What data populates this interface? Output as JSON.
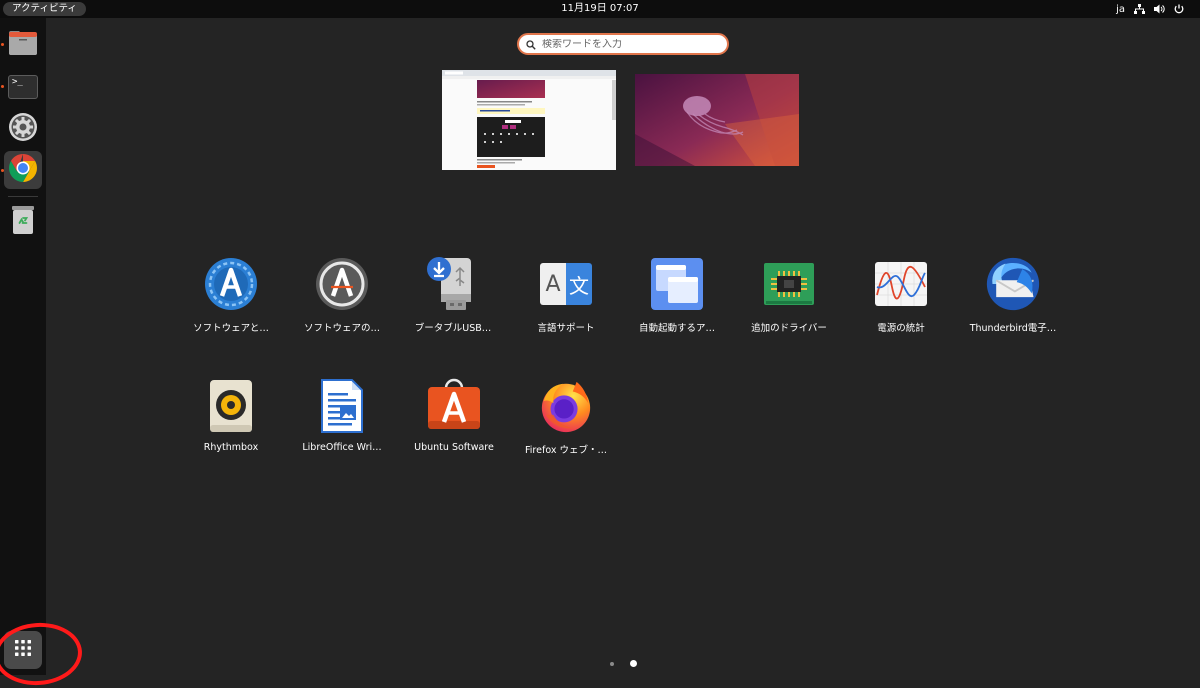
{
  "topbar": {
    "activities": "アクティビティ",
    "clock": "11月19日  07:07",
    "input_method": "ja"
  },
  "dock": {
    "items": [
      {
        "name": "files",
        "icon": "folder-icon",
        "running": true
      },
      {
        "name": "terminal",
        "icon": "terminal-icon",
        "running": true,
        "glyph": ">_"
      },
      {
        "name": "settings",
        "icon": "gear-icon",
        "running": false
      },
      {
        "name": "chrome",
        "icon": "chrome-icon",
        "running": true,
        "active": true
      },
      {
        "name": "trash",
        "icon": "trash-icon",
        "running": false
      }
    ],
    "show_apps_icon": "app-grid-icon"
  },
  "search": {
    "placeholder": "検索ワードを入力"
  },
  "windows": [
    {
      "name": "browser-window"
    },
    {
      "name": "desktop-wallpaper"
    }
  ],
  "apps": [
    {
      "label": "ソフトウェアと…",
      "icon": "software-updates-icon"
    },
    {
      "label": "ソフトウェアの…",
      "icon": "software-updater-icon"
    },
    {
      "label": "ブータブルUSB…",
      "icon": "usb-creator-icon"
    },
    {
      "label": "言語サポート",
      "icon": "language-support-icon",
      "glyph_a": "A",
      "glyph_b": "文"
    },
    {
      "label": "自動起動するア…",
      "icon": "startup-apps-icon"
    },
    {
      "label": "追加のドライバー",
      "icon": "drivers-chip-icon"
    },
    {
      "label": "電源の統計",
      "icon": "power-statistics-icon"
    },
    {
      "label": "Thunderbird電子…",
      "icon": "thunderbird-icon"
    },
    {
      "label": "Rhythmbox",
      "icon": "rhythmbox-icon"
    },
    {
      "label": "LibreOffice Wri…",
      "icon": "libreoffice-writer-icon"
    },
    {
      "label": "Ubuntu Software",
      "icon": "ubuntu-software-icon"
    },
    {
      "label": "Firefox ウェブ・…",
      "icon": "firefox-icon"
    }
  ],
  "pager": {
    "pages": 2,
    "current": 2
  },
  "colors": {
    "accent": "#e95420",
    "background": "#242424",
    "topbar": "#0d0d0d",
    "dock": "#111111",
    "annotation": "#ff1a1a"
  }
}
